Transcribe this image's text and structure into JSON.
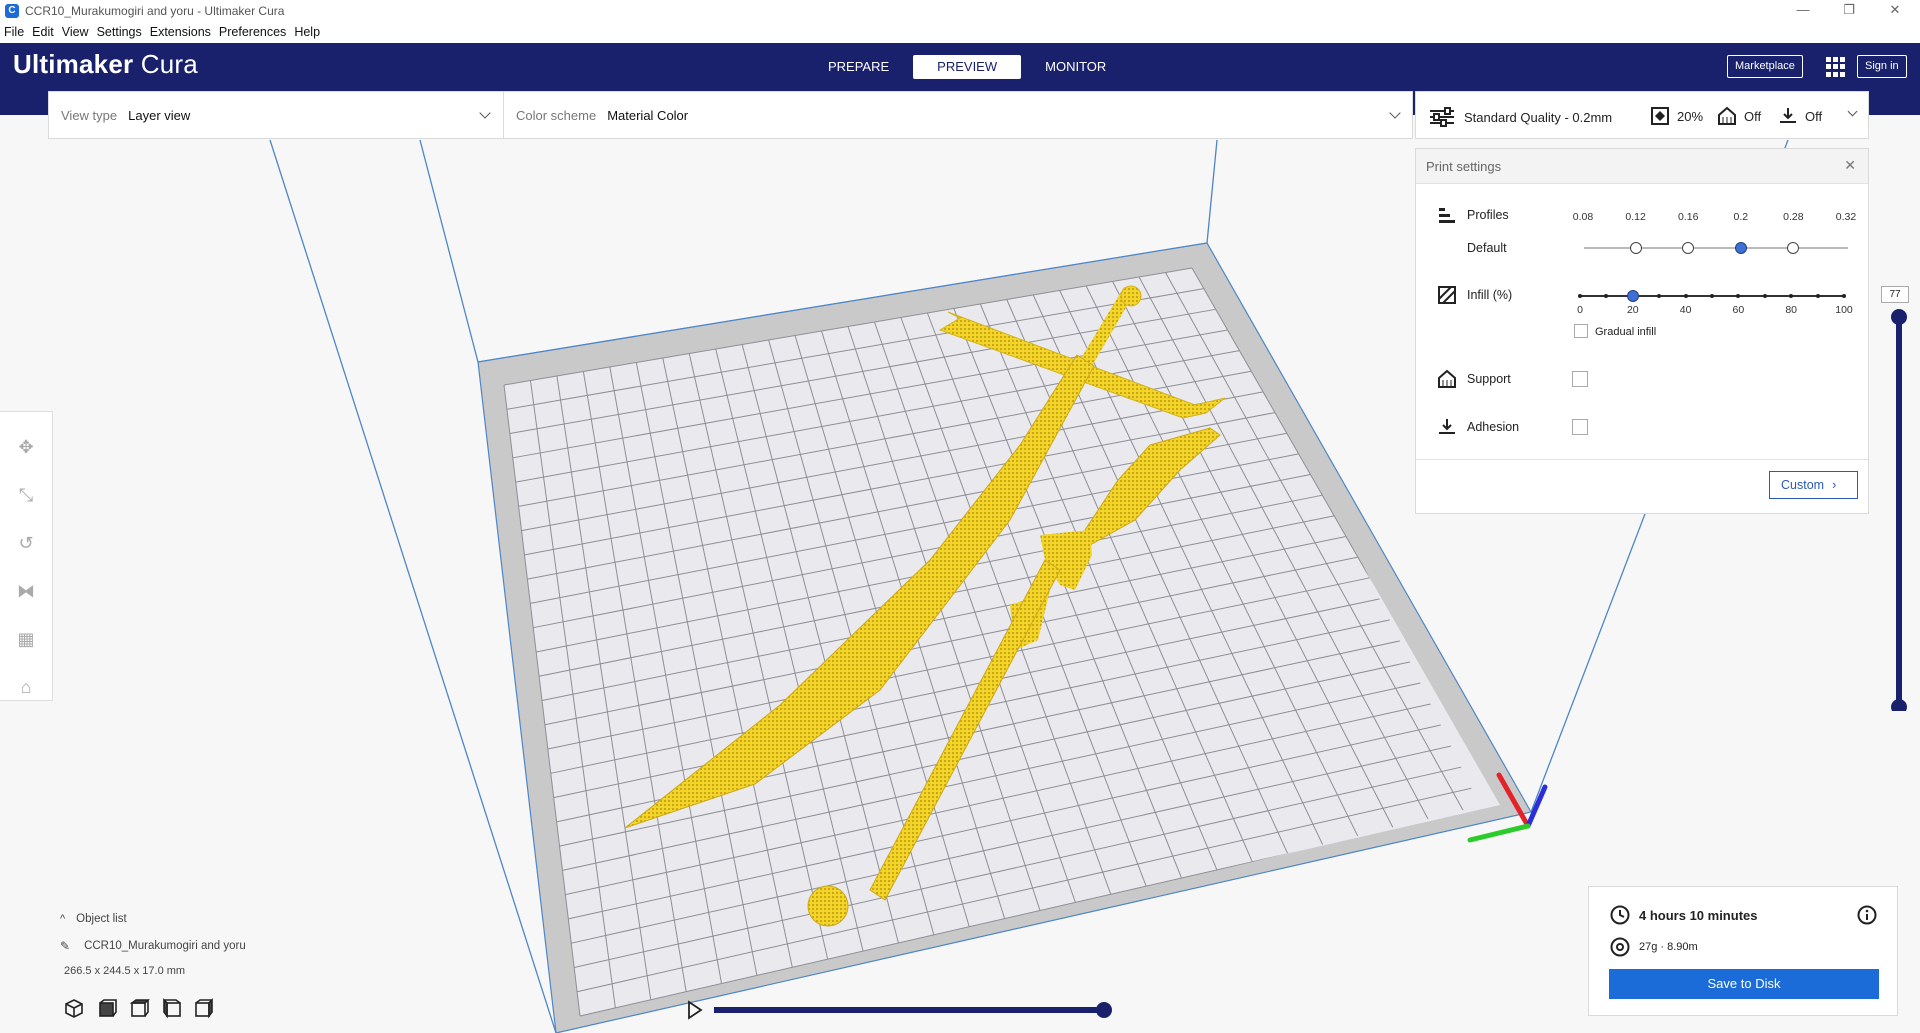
{
  "window": {
    "title": "CCR10_Murakumogiri and yoru - Ultimaker Cura"
  },
  "menu": [
    "File",
    "Edit",
    "View",
    "Settings",
    "Extensions",
    "Preferences",
    "Help"
  ],
  "header": {
    "logo_bold": "Ultimaker",
    "logo_light": " Cura",
    "stages": [
      "PREPARE",
      "PREVIEW",
      "MONITOR"
    ],
    "active_stage": "PREVIEW",
    "marketplace_label": "Marketplace",
    "signin_label": "Sign in"
  },
  "viewbar": {
    "view_type_label": "View type",
    "view_type_value": "Layer view",
    "color_scheme_label": "Color scheme",
    "color_scheme_value": "Material Color"
  },
  "printbar": {
    "quality": "Standard Quality - 0.2mm",
    "infill": "20%",
    "support": "Off",
    "adhesion": "Off"
  },
  "print_settings": {
    "title": "Print settings",
    "profiles_label": "Profiles",
    "profile_default": "Default",
    "profile_ticks": [
      "0.08",
      "0.12",
      "0.16",
      "0.2",
      "0.28",
      "0.32"
    ],
    "profile_selected": "0.2",
    "infill_label": "Infill (%)",
    "infill_ticks": [
      "0",
      "20",
      "40",
      "60",
      "80",
      "100"
    ],
    "infill_value": 20,
    "gradual_infill_label": "Gradual infill",
    "support_label": "Support",
    "adhesion_label": "Adhesion",
    "custom_label": "Custom"
  },
  "layer": {
    "current": "77"
  },
  "objects": {
    "object_list_label": "Object list",
    "object_name": "CCR10_Murakumogiri and yoru",
    "dimensions": "266.5 x 244.5 x 17.0 mm"
  },
  "estimate": {
    "time": "4 hours 10 minutes",
    "material": "27g · 8.90m",
    "save_label": "Save to Disk"
  },
  "colors": {
    "header": "#19216d",
    "accent": "#1b6bd9",
    "filament": "#f3d52a"
  }
}
